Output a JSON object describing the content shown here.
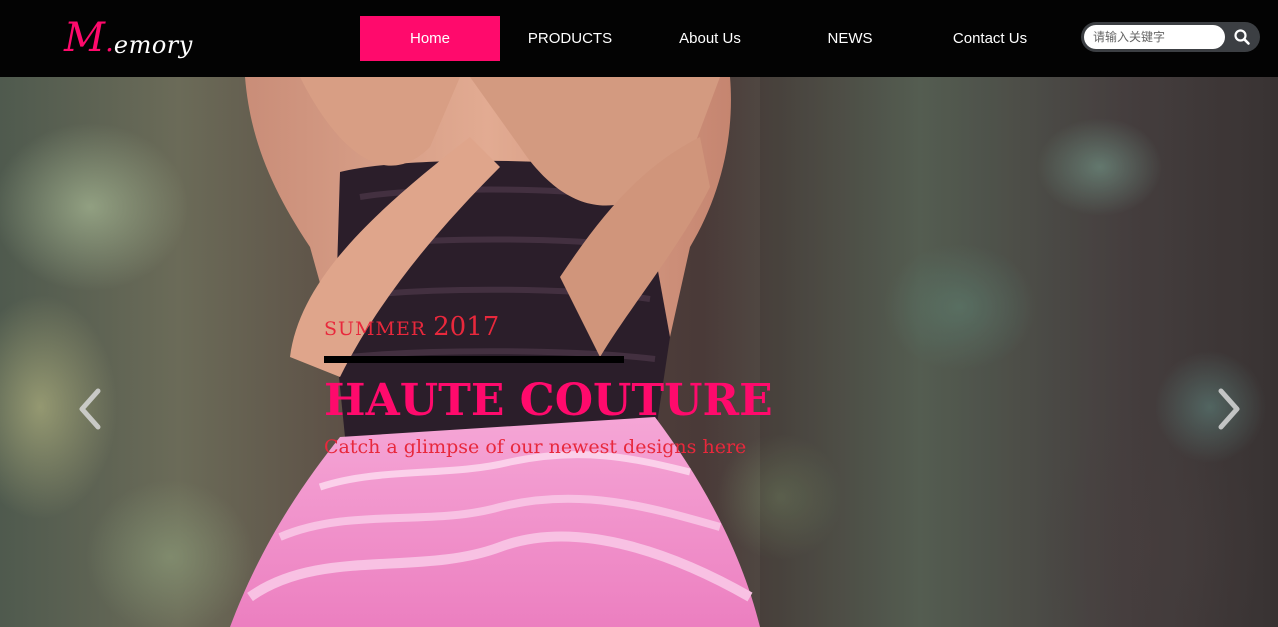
{
  "logo": {
    "initial": "M",
    "dot": ".",
    "rest": "emory"
  },
  "nav": {
    "items": [
      {
        "label": "Home",
        "active": true
      },
      {
        "label": "PRODUCTS",
        "active": false
      },
      {
        "label": "About Us",
        "active": false
      },
      {
        "label": "NEWS",
        "active": false
      },
      {
        "label": "Contact Us",
        "active": false
      }
    ]
  },
  "search": {
    "placeholder": "请输入关键字",
    "icon": "search-icon"
  },
  "hero": {
    "season": "SUMMER",
    "year": "2017",
    "title": "HAUTE COUTURE",
    "subtitle": "Catch a glimpse of our newest designs here",
    "prev_icon": "chevron-left-icon",
    "next_icon": "chevron-right-icon"
  },
  "colors": {
    "accent": "#ff0a6c",
    "caption_red": "#e8283c",
    "header_bg": "#030303"
  }
}
